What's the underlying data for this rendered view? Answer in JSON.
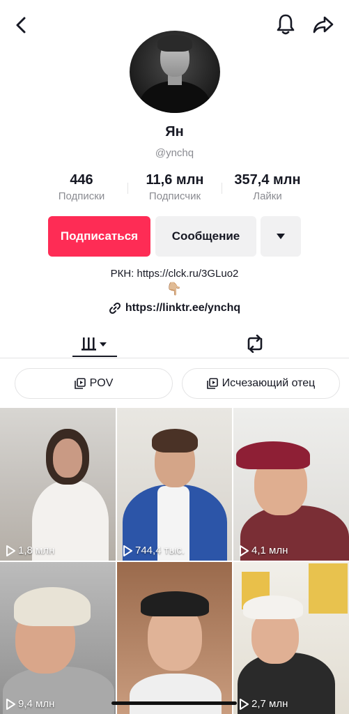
{
  "header": {
    "back_icon": "chevron-left-icon",
    "bell_icon": "bell-icon",
    "share_icon": "share-arrow-icon"
  },
  "profile": {
    "name": "Ян",
    "handle": "@ynchq",
    "stats": [
      {
        "value": "446",
        "label": "Подписки"
      },
      {
        "value": "11,6 млн",
        "label": "Подписчик"
      },
      {
        "value": "357,4 млн",
        "label": "Лайки"
      }
    ],
    "follow_label": "Подписаться",
    "message_label": "Сообщение",
    "bio_line": "РКН: https://clck.ru/3GLuo2",
    "bio_emoji": "👇🏼",
    "link": "https://linktr.ee/ynchq"
  },
  "playlists": [
    {
      "label": "POV",
      "icon": "playlist-icon"
    },
    {
      "label": "Исчезающий отец",
      "icon": "playlist-icon"
    }
  ],
  "videos": [
    {
      "views": "1,8 млн"
    },
    {
      "views": "744,4 тыс."
    },
    {
      "views": "4,1 млн"
    },
    {
      "views": "9,4 млн"
    },
    {
      "views": ""
    },
    {
      "views": "2,7 млн"
    }
  ],
  "colors": {
    "accent": "#fe2c55",
    "secondary_button": "#f1f1f2",
    "muted_text": "#8a8b91"
  }
}
